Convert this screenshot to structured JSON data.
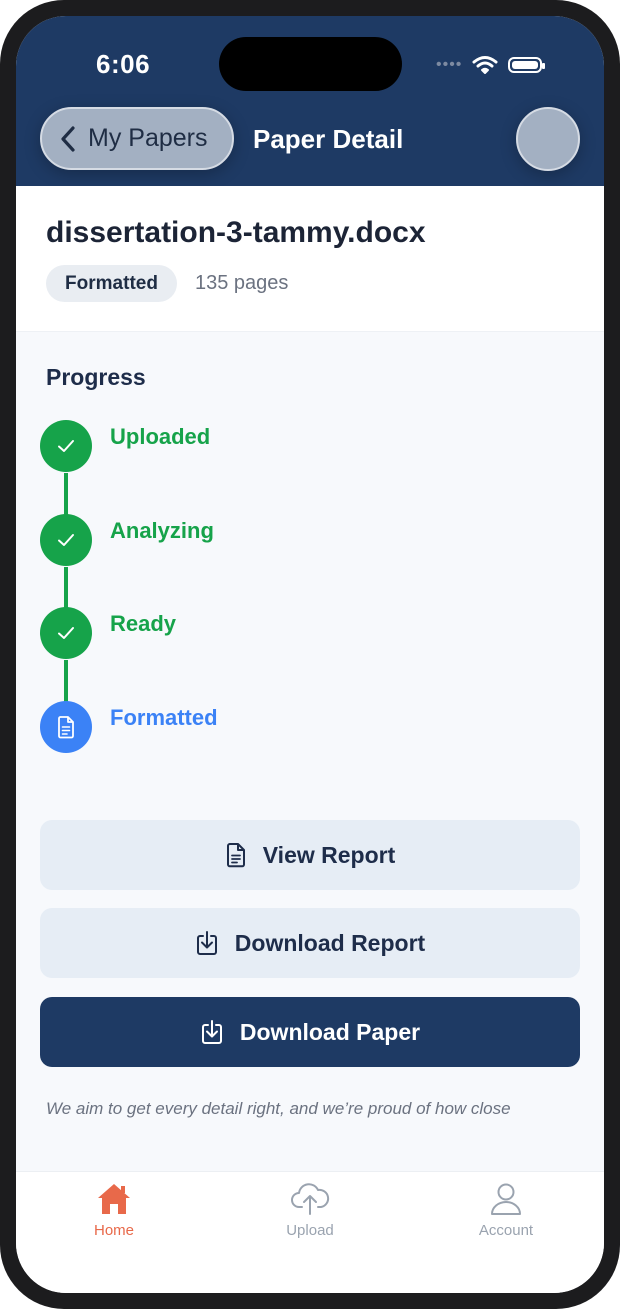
{
  "status_bar": {
    "time": "6:06"
  },
  "nav": {
    "back_label": "My Papers",
    "title": "Paper Detail"
  },
  "paper": {
    "filename": "dissertation-3-tammy.docx",
    "badge": "Formatted",
    "pages": "135 pages"
  },
  "progress": {
    "title": "Progress",
    "steps": [
      {
        "label": "Uploaded",
        "state": "done"
      },
      {
        "label": "Analyzing",
        "state": "done"
      },
      {
        "label": "Ready",
        "state": "done"
      },
      {
        "label": "Formatted",
        "state": "current"
      }
    ]
  },
  "actions": {
    "view_report": "View Report",
    "download_report": "Download Report",
    "download_paper": "Download Paper"
  },
  "footnote": "We aim to get every detail right, and we’re proud of how close",
  "tabs": [
    {
      "label": "Home",
      "icon": "home-icon",
      "active": true
    },
    {
      "label": "Upload",
      "icon": "cloud-upload-icon",
      "active": false
    },
    {
      "label": "Account",
      "icon": "person-icon",
      "active": false
    }
  ],
  "colors": {
    "nav_bg": "#1e3a64",
    "done_green": "#16a34a",
    "current_blue": "#3b82f6",
    "tab_active": "#e8694a",
    "tab_inactive": "#9aa3af"
  }
}
